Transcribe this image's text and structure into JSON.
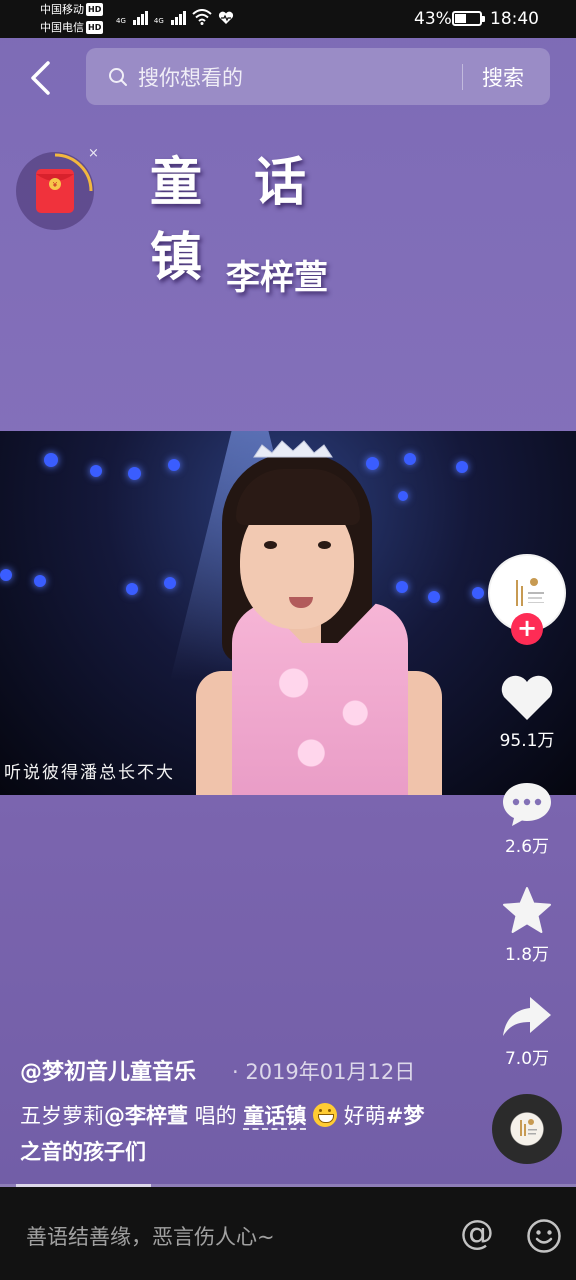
{
  "status_bar": {
    "carrier1": "中国移动",
    "carrier2": "中国电信",
    "hd_badge": "HD",
    "network": "4G",
    "battery": "43%",
    "time": "18:40",
    "icons": [
      "signal-icon",
      "wifi-icon",
      "heart-icon",
      "battery-icon"
    ]
  },
  "header": {
    "search_placeholder": "搜你想看的",
    "search_button": "搜索",
    "icons": [
      "back-icon",
      "search-icon"
    ]
  },
  "red_packet": {
    "icon": "red-envelope-icon",
    "close": "×"
  },
  "video": {
    "title": "童话镇",
    "artist": "李梓萱",
    "subtitle": "听说彼得潘总长不大"
  },
  "actions": {
    "likes": "95.1万",
    "comments": "2.6万",
    "favorites": "1.8万",
    "shares": "7.0万",
    "follow_symbol": "+",
    "icons": [
      "heart-icon",
      "comment-icon",
      "star-icon",
      "share-icon",
      "music-disc-icon"
    ]
  },
  "post": {
    "author": "@梦初音儿童音乐",
    "date": "· 2019年01月12日",
    "caption_prefix": "五岁萝莉",
    "caption_mention": "@李梓萱",
    "caption_mid": " 唱的",
    "caption_song": "童话镇",
    "caption_after": " 好萌",
    "caption_tag": "#梦之音的孩子们"
  },
  "playback": {
    "progress": 0.235
  },
  "comment_bar": {
    "placeholder": "善语结善缘，恶言伤人心~",
    "at_symbol": "@",
    "icons": [
      "at-icon",
      "emoji-icon"
    ]
  },
  "colors": {
    "background": "#7d6bb6",
    "follow": "#fe2c55",
    "bar": "#121212"
  }
}
